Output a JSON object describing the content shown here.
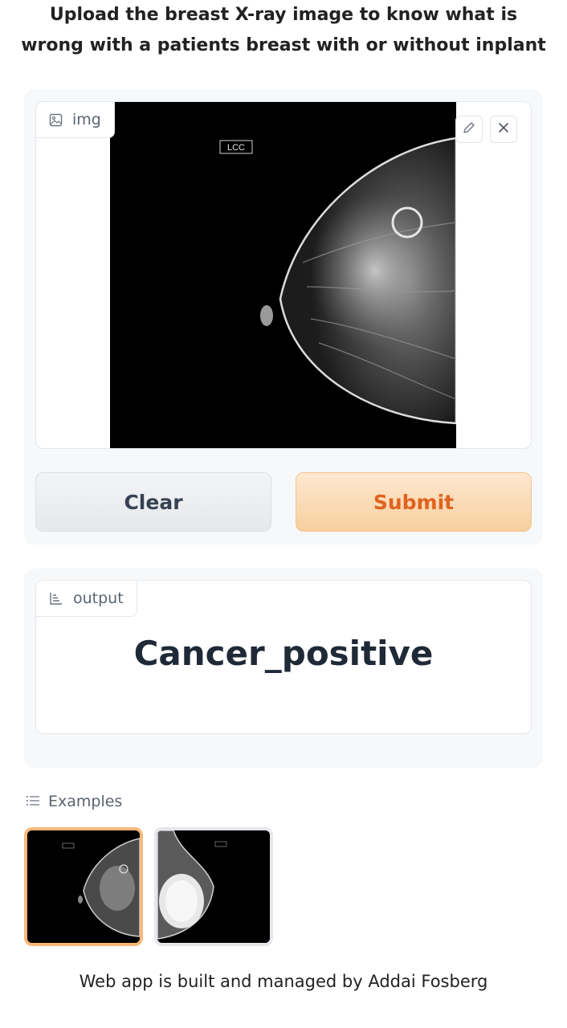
{
  "header": {
    "title": "Upload the breast X-ray image to know what is wrong with a patients breast with or without inplant"
  },
  "input": {
    "label": "img",
    "image_marker": "LCC",
    "clear_label": "Clear",
    "submit_label": "Submit"
  },
  "output": {
    "label": "output",
    "result": "Cancer_positive"
  },
  "examples": {
    "label": "Examples"
  },
  "footer": {
    "text": "Web app is built and managed by Addai Fosberg"
  },
  "colors": {
    "submit_accent": "#e0631f",
    "submit_bg": "#f8cf9f",
    "selected_example_border": "#f6b97a"
  }
}
